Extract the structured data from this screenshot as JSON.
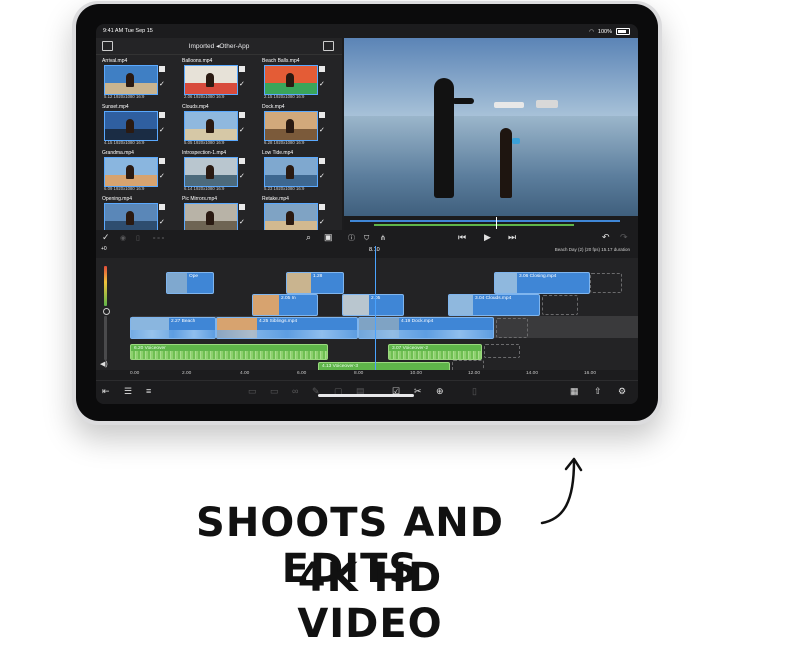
{
  "status_bar": {
    "time_date": "9:41 AM Tue Sep 15",
    "battery": "100%"
  },
  "browser": {
    "title": "Imported ◂Other-App",
    "clips": [
      {
        "name": "Arrival.mp4",
        "meta": "5.12  1920x1080  16:9",
        "sky": "#3f7fc4",
        "ground": "#c9b48f"
      },
      {
        "name": "Balloons.mp4",
        "meta": "2.06  1920x1080  16:9",
        "sky": "#e7e2d8",
        "ground": "#d84b3c"
      },
      {
        "name": "Beach Balls.mp4",
        "meta": "2.15  1920x1080  16:9",
        "sky": "#e45c36",
        "ground": "#3aa55a"
      },
      {
        "name": "Sunset.mp4",
        "meta": "4.15  1920x1080  16:9",
        "sky": "#2f5fa0",
        "ground": "#1a2c44"
      },
      {
        "name": "Clouds.mp4",
        "meta": "5.05  1920x1080  16:9",
        "sky": "#8fb8de",
        "ground": "#d6c8a6"
      },
      {
        "name": "Dock.mp4",
        "meta": "6.28  1920x1080  16:9",
        "sky": "#d2a97b",
        "ground": "#7b5a3a"
      },
      {
        "name": "Grandma.mp4",
        "meta": "6.09  1920x1080  16:9",
        "sky": "#8ab6df",
        "ground": "#d7a36f"
      },
      {
        "name": "Introspection-1.mp4",
        "meta": "6.14  1920x1080  16:9",
        "sky": "#b9c6cf",
        "ground": "#4c6a7c"
      },
      {
        "name": "Low Tide.mp4",
        "meta": "5.23  1920x1080  16:9",
        "sky": "#7fa8cf",
        "ground": "#3d6790"
      },
      {
        "name": "Opening.mp4",
        "meta": "",
        "sky": "#5a87b8",
        "ground": "#2e4d6f"
      },
      {
        "name": "Pic Mirrors.mp4",
        "meta": "",
        "sky": "#b8b3a7",
        "ground": "#6e6453"
      },
      {
        "name": "Retake.mp4",
        "meta": "",
        "sky": "#7fa3c4",
        "ground": "#d2b990"
      }
    ]
  },
  "timeline": {
    "timecode": "8.10",
    "project_info": "Beach Day (2) (20 fps)  15.17 duration",
    "meter_label": "+0",
    "top_clips": [
      {
        "label": "Ope"
      },
      {
        "label": "1.28"
      },
      {
        "label": "3.06  Closing.mp4"
      }
    ],
    "second_clips": [
      {
        "label": "2.05  In"
      },
      {
        "label": "2.05"
      },
      {
        "label": "3.04  Clouds.mp4"
      }
    ],
    "primary_clips": [
      {
        "label": "2.27  Beach"
      },
      {
        "label": "4.25  Siblings.mp4"
      },
      {
        "label": "4.19  Dock.mp4"
      }
    ],
    "audio_clips": [
      {
        "label": "6.20  Voiceover"
      },
      {
        "label": "3.07  Voiceover-2"
      },
      {
        "label": "4.13  Voiceover-3"
      }
    ],
    "ticks": [
      "0.00",
      "2.00",
      "4.00",
      "6.00",
      "8.00",
      "10.00",
      "12.00",
      "14.00",
      "16.00"
    ]
  },
  "caption": {
    "line1": "SHOOTS AND EDITS",
    "line2": "4K HD VIDEO"
  }
}
